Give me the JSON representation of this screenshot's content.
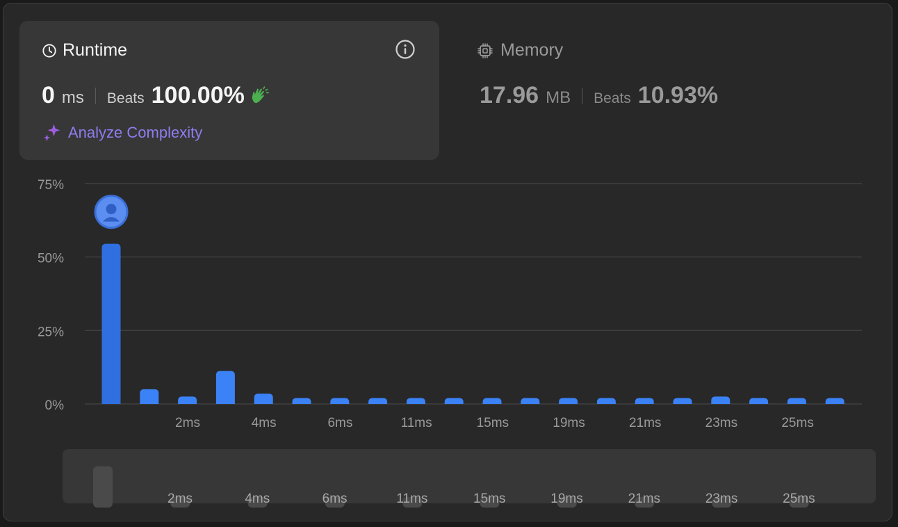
{
  "runtime": {
    "title": "Runtime",
    "value": "0",
    "unit": "ms",
    "beats_label": "Beats",
    "beats_value": "100.00%",
    "analyze_label": "Analyze Complexity"
  },
  "memory": {
    "title": "Memory",
    "value": "17.96",
    "unit": "MB",
    "beats_label": "Beats",
    "beats_value": "10.93%"
  },
  "colors": {
    "bar": "#3b82f6",
    "bar_highlight": "#2f6fe0",
    "mini_bar": "#4a4a4a",
    "accent_purple": "#8f7cf0",
    "clap_green": "#4caf50"
  },
  "chart_data": {
    "type": "bar",
    "x_ticks": [
      "2ms",
      "4ms",
      "6ms",
      "11ms",
      "15ms",
      "19ms",
      "21ms",
      "23ms",
      "25ms"
    ],
    "y_ticks": [
      "0%",
      "25%",
      "50%",
      "75%"
    ],
    "ylim": [
      0,
      75
    ],
    "values": [
      54.5,
      5,
      2.5,
      11.2,
      3.5,
      2,
      2,
      2,
      2,
      2,
      2,
      2,
      2,
      2,
      2,
      2,
      2.5,
      2,
      2,
      2
    ],
    "highlight_index": 0
  }
}
